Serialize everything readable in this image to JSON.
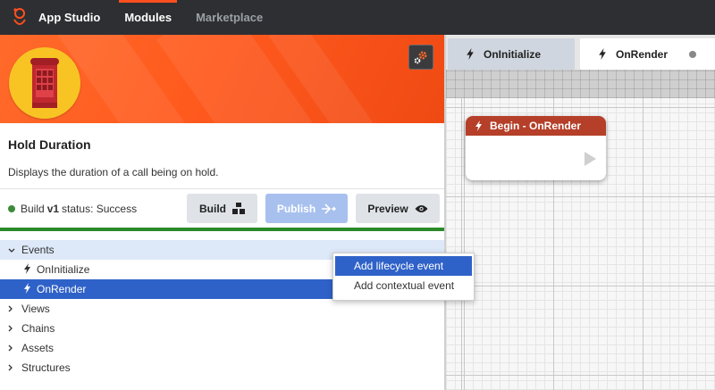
{
  "app": {
    "name": "App Studio",
    "nav": [
      "Modules",
      "Marketplace"
    ],
    "accent": "#ff4f1f"
  },
  "module": {
    "title": "Hold Duration",
    "description": "Displays the duration of a call being on hold.",
    "icon": "phone-booth-icon"
  },
  "status": {
    "prefix": "Build",
    "version": "v1",
    "suffix": "status: Success",
    "color": "#3b8b3a"
  },
  "buttons": {
    "build": "Build",
    "publish": "Publish",
    "preview": "Preview"
  },
  "tree": {
    "events": "Events",
    "children": [
      "OnInitialize",
      "OnRender"
    ],
    "views": "Views",
    "chains": "Chains",
    "assets": "Assets",
    "structures": "Structures"
  },
  "context_menu": {
    "items": [
      "Add lifecycle event",
      "Add contextual event"
    ]
  },
  "canvas": {
    "tabs": [
      "OnInitialize",
      "OnRender"
    ],
    "node_title": "Begin - OnRender",
    "node_color": "#b53f29"
  }
}
